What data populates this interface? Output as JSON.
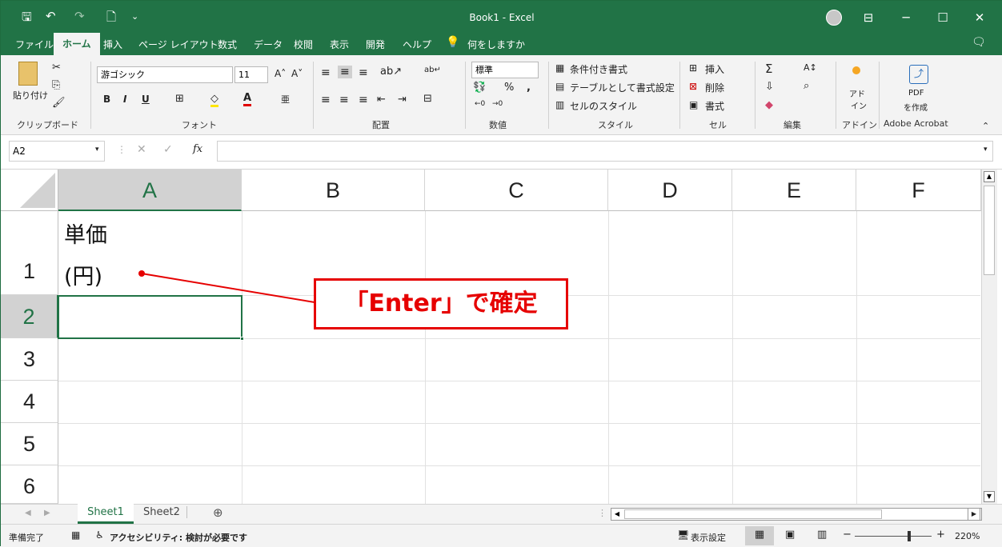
{
  "title": "Book1 - Excel",
  "menu": [
    "ファイル",
    "ホーム",
    "挿入",
    "ページ レイアウト",
    "数式",
    "データ",
    "校閲",
    "表示",
    "開発",
    "ヘルプ",
    "何をしますか"
  ],
  "ribbon": {
    "clipboard": {
      "paste": "貼り付け",
      "label": "クリップボード"
    },
    "font": {
      "name": "游ゴシック",
      "size": "11",
      "label": "フォント"
    },
    "alignment": {
      "label": "配置"
    },
    "number": {
      "format": "標準",
      "percent": "%",
      "comma": ",",
      "label": "数値"
    },
    "styles": {
      "conditional": "条件付き書式",
      "table": "テーブルとして書式設定",
      "cell_styles": "セルのスタイル",
      "label": "スタイル"
    },
    "cells": {
      "insert": "挿入",
      "delete": "削除",
      "format": "書式",
      "label": "セル"
    },
    "editing": {
      "label": "編集"
    },
    "addins": {
      "line1": "アド",
      "line2": "イン",
      "label": "アドイン"
    },
    "acrobat": {
      "line1": "PDF",
      "line2": "を作成",
      "label": "Adobe Acrobat"
    }
  },
  "formula_bar": {
    "name_box": "A2",
    "fx": "fx",
    "content": ""
  },
  "columns": [
    "A",
    "B",
    "C",
    "D",
    "E",
    "F"
  ],
  "rows": [
    "1",
    "2",
    "3",
    "4",
    "5",
    "6"
  ],
  "cells": {
    "A1_line1": "単価",
    "A1_line2": "(円)"
  },
  "annotation": "「Enter」で確定",
  "sheets": [
    "Sheet1",
    "Sheet2"
  ],
  "status": {
    "ready": "準備完了",
    "accessibility": "アクセシビリティ: 検討が必要です",
    "display_settings": "表示設定",
    "zoom": "220%"
  }
}
